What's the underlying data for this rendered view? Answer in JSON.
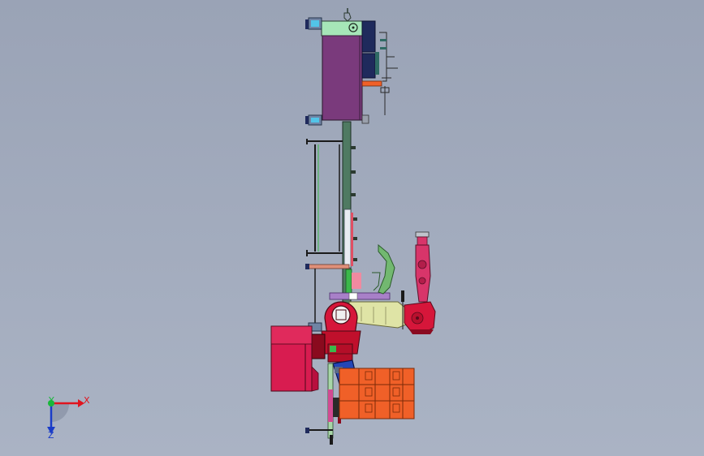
{
  "viewport": {
    "background": "#a0a9bb"
  },
  "triad": {
    "x_label": "X",
    "y_label": "Y",
    "z_label": "Z",
    "x_color": "#e0141e",
    "y_color": "#18b83a",
    "z_color": "#1a3cc8"
  },
  "colors": {
    "gearbox_top": "#a6e6b8",
    "housing": "#7a3a7c",
    "column": "#4f7a62",
    "robot_red": "#d6163a",
    "robot_pink": "#d8356a",
    "boom": "#dfe4a6",
    "cabinet": "#d81c50",
    "motor_blue": "#2346b6",
    "pallet_orange": "#f06028",
    "light_blue": "#52c4e8",
    "navy": "#1f2a5c"
  }
}
